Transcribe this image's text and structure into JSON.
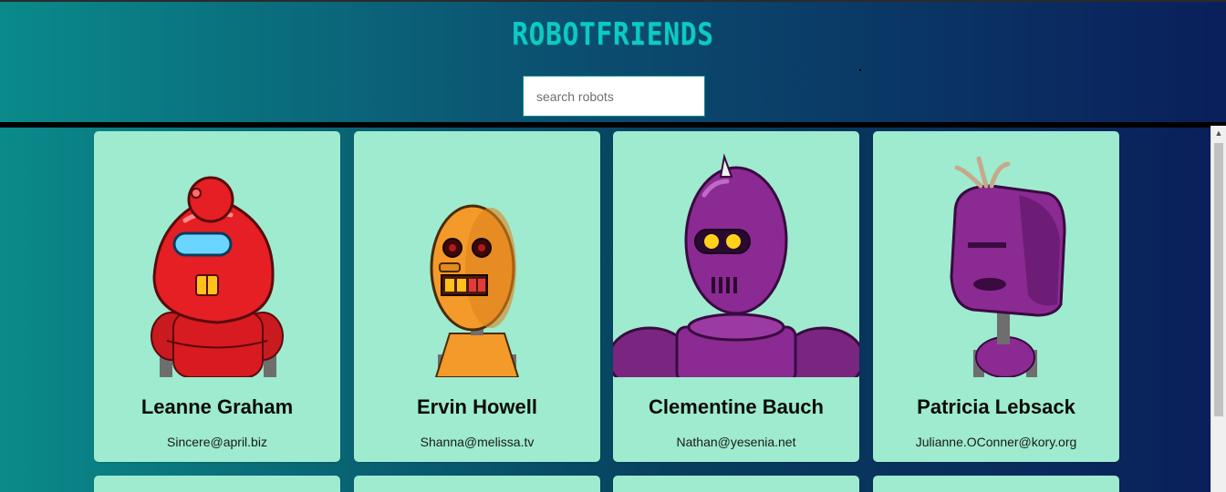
{
  "app": {
    "title": "ROBOTFRIENDS"
  },
  "search": {
    "placeholder": "search robots",
    "value": ""
  },
  "robots": [
    {
      "name": "Leanne Graham",
      "email": "Sincere@april.biz",
      "color": "#e51f23"
    },
    {
      "name": "Ervin Howell",
      "email": "Shanna@melissa.tv",
      "color": "#f39a2a"
    },
    {
      "name": "Clementine Bauch",
      "email": "Nathan@yesenia.net",
      "color": "#8b2a93"
    },
    {
      "name": "Patricia Lebsack",
      "email": "Julianne.OConner@kory.org",
      "color": "#8b2a93"
    }
  ],
  "colors": {
    "card": "#9eebcf",
    "title": "#0ccac4",
    "header_left": "#0a8a8a",
    "header_right": "#0a1f5b"
  }
}
